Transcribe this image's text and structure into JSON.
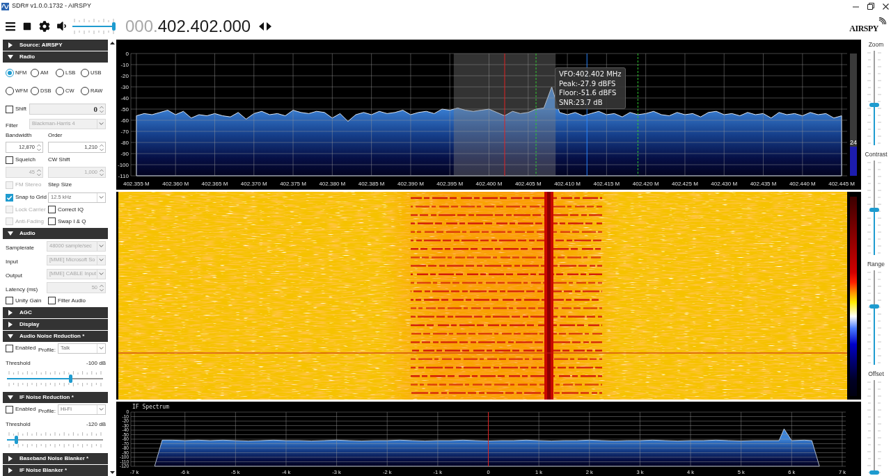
{
  "window": {
    "title": "SDR# v1.0.0.1732 - AIRSPY"
  },
  "toolbar": {
    "volume": {
      "level": 1
    },
    "frequency": {
      "inactive_digits": "000.",
      "active_digits": "402.402.000"
    },
    "logo": {
      "text": "AIRSPY"
    }
  },
  "left_panel": {
    "sections": [
      {
        "title": "Source: AIRSPY",
        "expanded": false
      },
      {
        "title": "Radio",
        "expanded": true,
        "rows": [
          {
            "kind": "radios",
            "options": [
              {
                "label": "NFM",
                "selected": true
              },
              {
                "label": "AM",
                "selected": false
              },
              {
                "label": "LSB",
                "selected": false
              },
              {
                "label": "USB",
                "selected": false
              },
              {
                "label": "WFM",
                "selected": false
              },
              {
                "label": "DSB",
                "selected": false
              },
              {
                "label": "CW",
                "selected": false
              },
              {
                "label": "RAW",
                "selected": false
              }
            ]
          },
          {
            "kind": "check_spin",
            "checkbox": {
              "label": "Shift",
              "checked": false,
              "disabled": false
            },
            "field": {
              "value": "0"
            }
          },
          {
            "kind": "combo",
            "label": "Filter",
            "select": {
              "value": "Blackman-Harris 4",
              "disabled": true
            }
          },
          {
            "kind": "labels",
            "labels": [
              "Bandwidth",
              "Order"
            ]
          },
          {
            "kind": "spins",
            "fields": [
              {
                "value": "12,870",
                "disabled": false
              },
              {
                "value": "1,210",
                "disabled": false
              }
            ]
          },
          {
            "kind": "check_label",
            "checkbox": {
              "label": "Squelch",
              "checked": false,
              "disabled": false
            },
            "label": "CW Shift"
          },
          {
            "kind": "spins",
            "fields": [
              {
                "value": "45",
                "disabled": true
              },
              {
                "value": "1,000",
                "disabled": true
              }
            ]
          },
          {
            "kind": "check_label",
            "checkbox": {
              "label": "FM Stereo",
              "checked": false,
              "disabled": true
            },
            "label": "Step Size"
          },
          {
            "kind": "check_select",
            "checkbox": {
              "label": "Snap to Grid",
              "checked": true,
              "disabled": false
            },
            "select": {
              "value": "12.5 kHz",
              "disabled": false
            }
          },
          {
            "kind": "checks",
            "checkboxes": [
              {
                "label": "Lock Carrier",
                "checked": false,
                "disabled": true
              },
              {
                "label": "Correct IQ",
                "checked": false,
                "disabled": false
              }
            ]
          },
          {
            "kind": "checks",
            "checkboxes": [
              {
                "label": "Anti-Fading",
                "checked": false,
                "disabled": true
              },
              {
                "label": "Swap I & Q",
                "checked": false,
                "disabled": false
              }
            ]
          }
        ]
      },
      {
        "title": "Audio",
        "expanded": true,
        "rows": [
          {
            "kind": "select",
            "label": "Samplerate",
            "select": {
              "value": "48000 sample/sec",
              "disabled": true
            }
          },
          {
            "kind": "select",
            "label": "Input",
            "select": {
              "value": "[MME] Microsoft So",
              "disabled": true
            }
          },
          {
            "kind": "select",
            "label": "Output",
            "select": {
              "value": "[MME] CABLE Input",
              "disabled": true
            }
          },
          {
            "kind": "spin",
            "label": "Latency (ms)",
            "field": {
              "value": "50",
              "disabled": true
            }
          },
          {
            "kind": "checks",
            "checkboxes": [
              {
                "label": "Unity Gain",
                "checked": false,
                "disabled": false
              },
              {
                "label": "Filter Audio",
                "checked": false,
                "disabled": false
              }
            ]
          }
        ]
      },
      {
        "title": "AGC",
        "expanded": false
      },
      {
        "title": "Display",
        "expanded": false
      },
      {
        "title": "Audio Noise Reduction *",
        "expanded": true,
        "rows": [
          {
            "kind": "profile",
            "checkbox": {
              "label": "Enabled",
              "checked": false,
              "disabled": false
            },
            "label": "Profile:",
            "select": {
              "value": "Talk",
              "disabled": false
            }
          },
          {
            "kind": "threshold",
            "label": "Threshold",
            "reading": "-100 dB",
            "level": 0.67
          }
        ]
      },
      {
        "title": "IF Noise Reduction *",
        "expanded": true,
        "rows": [
          {
            "kind": "profile",
            "checkbox": {
              "label": "Enabled",
              "checked": false,
              "disabled": false
            },
            "label": "Profile:",
            "select": {
              "value": "Hi-Fi",
              "disabled": false
            }
          },
          {
            "kind": "threshold",
            "label": "Threshold",
            "reading": "-120 dB",
            "level": 0.08
          }
        ]
      },
      {
        "title": "Baseband Noise Blanker *",
        "expanded": false
      },
      {
        "title": "IF Noise Blanker *",
        "expanded": false
      }
    ]
  },
  "spectrum": {
    "chart_data": [
      {
        "type": "area",
        "x": [
          402.355,
          402.355,
          402.356,
          402.357,
          402.358,
          402.359,
          402.36,
          402.361,
          402.362,
          402.363,
          402.364,
          402.365,
          402.366,
          402.367,
          402.368,
          402.369,
          402.37,
          402.371,
          402.372,
          402.373,
          402.374,
          402.375,
          402.376,
          402.377,
          402.378,
          402.379,
          402.38,
          402.381,
          402.382,
          402.383,
          402.384,
          402.385,
          402.386,
          402.387,
          402.388,
          402.389,
          402.39,
          402.391,
          402.392,
          402.393,
          402.394,
          402.395,
          402.396,
          402.397,
          402.398,
          402.399,
          402.4,
          402.401,
          402.402,
          402.403,
          402.404,
          402.405,
          402.406,
          402.407,
          402.408,
          402.409,
          402.41,
          402.411,
          402.412,
          402.413,
          402.414,
          402.415,
          402.416,
          402.417,
          402.418,
          402.419,
          402.42,
          402.421,
          402.422,
          402.423,
          402.424,
          402.425,
          402.426,
          402.427,
          402.428,
          402.429,
          402.43,
          402.431,
          402.432,
          402.433,
          402.434,
          402.435,
          402.436,
          402.437,
          402.438,
          402.439,
          402.44,
          402.441,
          402.442,
          402.443,
          402.444,
          402.445,
          402.445
        ],
        "values": [
          -110,
          -56,
          -54,
          -55,
          -53,
          -51,
          -55,
          -52,
          -58,
          -55,
          -56,
          -54,
          -56,
          -57,
          -53,
          -59,
          -54,
          -52,
          -55,
          -54,
          -56,
          -51,
          -53,
          -54,
          -52,
          -53,
          -58,
          -54,
          -61,
          -55,
          -53,
          -55,
          -52,
          -54,
          -53,
          -51,
          -55,
          -53,
          -52,
          -54,
          -50,
          -51,
          -49,
          -51,
          -52,
          -51,
          -50,
          -53,
          -56,
          -52,
          -54,
          -53,
          -50,
          -49,
          -30,
          -53,
          -55,
          -53,
          -56,
          -54,
          -52,
          -55,
          -54,
          -57,
          -53,
          -55,
          -54,
          -52,
          -55,
          -56,
          -53,
          -55,
          -54,
          -57,
          -53,
          -52,
          -55,
          -54,
          -56,
          -53,
          -55,
          -54,
          -58,
          -53,
          -55,
          -54,
          -56,
          -53,
          -55,
          -54,
          -58,
          -56,
          -110
        ],
        "color": "#dbe6f5",
        "xlim": [
          402.3543,
          402.4457
        ],
        "ylim": [
          -110,
          0
        ],
        "xticks": [
          {
            "value": 402.355,
            "label": "402.355 M"
          },
          {
            "value": 402.36,
            "label": "402.360 M"
          },
          {
            "value": 402.365,
            "label": "402.365 M"
          },
          {
            "value": 402.37,
            "label": "402.370 M"
          },
          {
            "value": 402.375,
            "label": "402.375 M"
          },
          {
            "value": 402.38,
            "label": "402.380 M"
          },
          {
            "value": 402.385,
            "label": "402.385 M"
          },
          {
            "value": 402.39,
            "label": "402.390 M"
          },
          {
            "value": 402.395,
            "label": "402.395 M"
          },
          {
            "value": 402.4,
            "label": "402.400 M"
          },
          {
            "value": 402.405,
            "label": "402.405 M"
          },
          {
            "value": 402.41,
            "label": "402.410 M"
          },
          {
            "value": 402.415,
            "label": "402.415 M"
          },
          {
            "value": 402.42,
            "label": "402.420 M"
          },
          {
            "value": 402.425,
            "label": "402.425 M"
          },
          {
            "value": 402.43,
            "label": "402.430 M"
          },
          {
            "value": 402.435,
            "label": "402.435 M"
          },
          {
            "value": 402.44,
            "label": "402.440 M"
          },
          {
            "value": 402.445,
            "label": "402.445 M"
          }
        ],
        "yticks": [
          0,
          -10,
          -20,
          -30,
          -40,
          -50,
          -60,
          -70,
          -80,
          -90,
          -100,
          -110
        ],
        "grid": true,
        "bands": [
          {
            "axis": "x",
            "from": 402.3955,
            "to": 402.4085,
            "color": "#808080"
          }
        ],
        "ref_lines": [
          {
            "axis": "x",
            "value": 402.402,
            "color": "#e02424",
            "line_style": "solid"
          },
          {
            "axis": "x",
            "value": 402.406,
            "color": "#2ec82e",
            "line_style": "dashed"
          },
          {
            "axis": "x",
            "value": 402.4125,
            "color": "#2a86ff",
            "line_style": "solid"
          },
          {
            "axis": "x",
            "value": 402.419,
            "color": "#2ec82e",
            "line_style": "dashed"
          }
        ]
      }
    ],
    "tooltip": {
      "lines": [
        "VFO:402.402 MHz",
        "Peak:-27.9 dBFS",
        "Floor:-51.6 dBFS",
        "SNR:23.7 dB"
      ]
    },
    "level_meter": {
      "reading": "24",
      "level": 0.24
    }
  },
  "if_spectrum": {
    "chart_data": [
      {
        "type": "area",
        "title": "IF Spectrum",
        "x": [
          -6.6,
          -6.45,
          -6.25,
          -6,
          -5.75,
          -5.5,
          -5.25,
          -5,
          -4.75,
          -4.5,
          -4.25,
          -4,
          -3.75,
          -3.5,
          -3.25,
          -3,
          -2.75,
          -2.5,
          -2.25,
          -2,
          -1.75,
          -1.5,
          -1.25,
          -1,
          -0.75,
          -0.5,
          -0.25,
          0,
          0.25,
          0.5,
          0.75,
          1,
          1.25,
          1.5,
          1.75,
          2,
          2.25,
          2.5,
          2.75,
          3,
          3.25,
          3.5,
          3.75,
          4,
          4.25,
          4.5,
          4.75,
          5,
          5.25,
          5.5,
          5.75,
          5.85,
          6,
          6.25,
          6.4,
          6.55
        ],
        "values": [
          -120,
          -62,
          -62,
          -63,
          -62,
          -63,
          -62,
          -63,
          -64,
          -63,
          -62,
          -63,
          -63,
          -64,
          -63,
          -62,
          -63,
          -64,
          -63,
          -63,
          -62,
          -63,
          -64,
          -63,
          -63,
          -62,
          -63,
          -64,
          -63,
          -63,
          -62,
          -63,
          -64,
          -63,
          -63,
          -62,
          -63,
          -64,
          -63,
          -63,
          -62,
          -63,
          -64,
          -63,
          -63,
          -62,
          -63,
          -64,
          -63,
          -63,
          -63,
          -37,
          -63,
          -62,
          -63,
          -120
        ],
        "color": "#dbe6f5",
        "xlim": [
          -7.07,
          7.07
        ],
        "ylim": [
          -120,
          0
        ],
        "xticks": [
          {
            "value": -7,
            "label": "-7 k"
          },
          {
            "value": -6,
            "label": "-6 k"
          },
          {
            "value": -5,
            "label": "-5 k"
          },
          {
            "value": -4,
            "label": "-4 k"
          },
          {
            "value": -3,
            "label": "-3 k"
          },
          {
            "value": -2,
            "label": "-2 k"
          },
          {
            "value": -1,
            "label": "-1 k"
          },
          {
            "value": 0,
            "label": "0"
          },
          {
            "value": 1,
            "label": "1 k"
          },
          {
            "value": 2,
            "label": "2 k"
          },
          {
            "value": 3,
            "label": "3 k"
          },
          {
            "value": 4,
            "label": "4 k"
          },
          {
            "value": 5,
            "label": "5 k"
          },
          {
            "value": 6,
            "label": "6 k"
          },
          {
            "value": 7,
            "label": "7 k"
          }
        ],
        "yticks": [
          0,
          -10,
          -20,
          -30,
          -40,
          -50,
          -60,
          -70,
          -80,
          -90,
          -100,
          -110,
          -120
        ],
        "grid": true,
        "ref_lines": [
          {
            "axis": "x",
            "value": 0,
            "color": "#e02424",
            "line_style": "solid"
          }
        ]
      }
    ]
  },
  "display_sliders": [
    {
      "label": "Zoom",
      "level": 0.42
    },
    {
      "label": "Contrast",
      "level": 0.48
    },
    {
      "label": "Range",
      "level": 0.62
    },
    {
      "label": "Offset",
      "level": 0
    }
  ]
}
